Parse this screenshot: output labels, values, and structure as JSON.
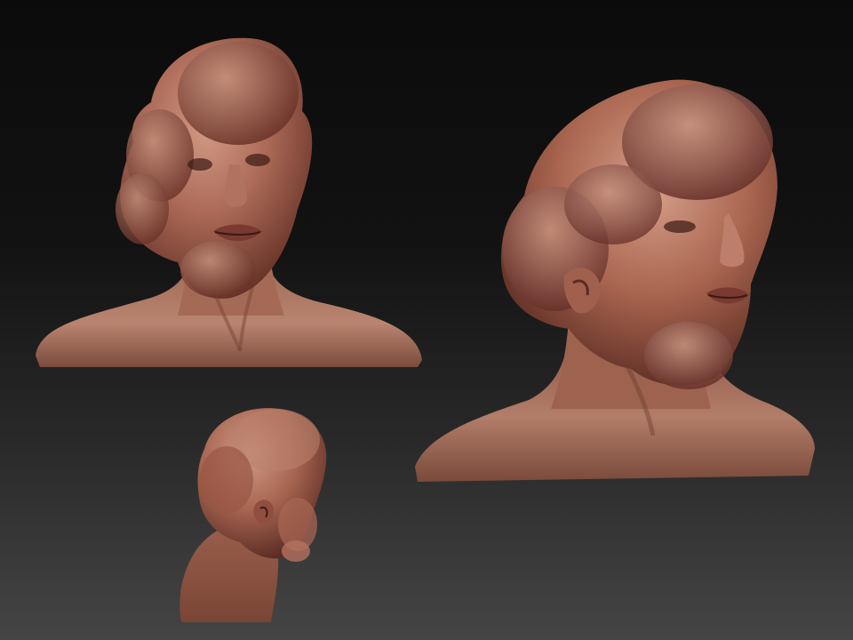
{
  "scene": {
    "background_top": "#0b0b0b",
    "background_bottom": "#454545",
    "skin_base": "#a4604e",
    "skin_light": "#c98f7a",
    "skin_shadow": "#5a2b22",
    "views": [
      {
        "id": "front",
        "label": "front-view"
      },
      {
        "id": "three-quarter",
        "label": "three-quarter-view"
      },
      {
        "id": "back",
        "label": "back-three-quarter-view"
      }
    ]
  }
}
